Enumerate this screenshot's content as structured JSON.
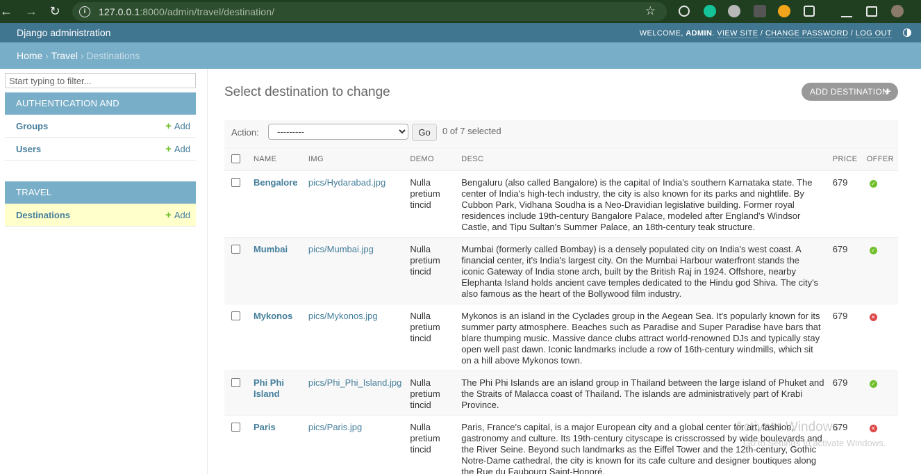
{
  "browser": {
    "url_host": "127.0.0.1",
    "url_rest": ":8000/admin/travel/destination/"
  },
  "header": {
    "brand": "Django administration",
    "welcome": "WELCOME,",
    "user": "ADMIN",
    "view_site": "VIEW SITE",
    "change_password": "CHANGE PASSWORD",
    "log_out": "LOG OUT"
  },
  "breadcrumbs": {
    "home": "Home",
    "app": "Travel",
    "current": "Destinations"
  },
  "sidebar": {
    "filter_placeholder": "Start typing to filter...",
    "auth_caption": "AUTHENTICATION AND AUTHORIZATION",
    "travel_caption": "TRAVEL",
    "items": [
      {
        "label": "Groups",
        "add": "Add"
      },
      {
        "label": "Users",
        "add": "Add"
      },
      {
        "label": "Destinations",
        "add": "Add"
      }
    ]
  },
  "main": {
    "title": "Select destination to change",
    "add_button": "ADD DESTINATION",
    "action_label": "Action:",
    "action_selected": "---------",
    "go_label": "Go",
    "selection_count": "0 of 7 selected",
    "columns": [
      "NAME",
      "IMG",
      "DEMO",
      "DESC",
      "PRICE",
      "OFFER"
    ],
    "rows": [
      {
        "name": "Bengalore",
        "img": "pics/Hydarabad.jpg",
        "demo": "Nulla pretium tincid",
        "desc": "Bengaluru (also called Bangalore) is the capital of India's southern Karnataka state. The center of India's high-tech industry, the city is also known for its parks and nightlife. By Cubbon Park, Vidhana Soudha is a Neo-Dravidian legislative building. Former royal residences include 19th-century Bangalore Palace, modeled after England's Windsor Castle, and Tipu Sultan's Summer Palace, an 18th-century teak structure.",
        "price": "679",
        "offer": true
      },
      {
        "name": "Mumbai",
        "img": "pics/Mumbai.jpg",
        "demo": "Nulla pretium tincid",
        "desc": "Mumbai (formerly called Bombay) is a densely populated city on India's west coast. A financial center, it's India's largest city. On the Mumbai Harbour waterfront stands the iconic Gateway of India stone arch, built by the British Raj in 1924. Offshore, nearby Elephanta Island holds ancient cave temples dedicated to the Hindu god Shiva. The city's also famous as the heart of the Bollywood film industry.",
        "price": "679",
        "offer": true
      },
      {
        "name": "Mykonos",
        "img": "pics/Mykonos.jpg",
        "demo": "Nulla pretium tincid",
        "desc": "Mykonos is an island in the Cyclades group in the Aegean Sea. It's popularly known for its summer party atmosphere. Beaches such as Paradise and Super Paradise have bars that blare thumping music. Massive dance clubs attract world-renowned DJs and typically stay open well past dawn. Iconic landmarks include a row of 16th-century windmills, which sit on a hill above Mykonos town.",
        "price": "679",
        "offer": false
      },
      {
        "name": "Phi Phi Island",
        "img": "pics/Phi_Phi_Island.jpg",
        "demo": "Nulla pretium tincid",
        "desc": "The Phi Phi Islands are an island group in Thailand between the large island of Phuket and the Straits of Malacca coast of Thailand. The islands are administratively part of Krabi Province.",
        "price": "679",
        "offer": true
      },
      {
        "name": "Paris",
        "img": "pics/Paris.jpg",
        "demo": "Nulla pretium tincid",
        "desc": "Paris, France's capital, is a major European city and a global center for art, fashion, gastronomy and culture. Its 19th-century cityscape is crisscrossed by wide boulevards and the River Seine. Beyond such landmarks as the Eiffel Tower and the 12th-century, Gothic Notre-Dame cathedral, the city is known for its cafe culture and designer boutiques along the Rue du Faubourg Saint-Honoré.",
        "price": "679",
        "offer": false
      }
    ]
  },
  "watermark": {
    "title": "Activate Windows",
    "subtitle": "Go to Settings to activate Windows."
  },
  "colors": {
    "header": "#417690",
    "breadcrumb": "#79aec8",
    "link": "#447e9b",
    "ok": "#70bf2b",
    "no": "#dd4646"
  }
}
